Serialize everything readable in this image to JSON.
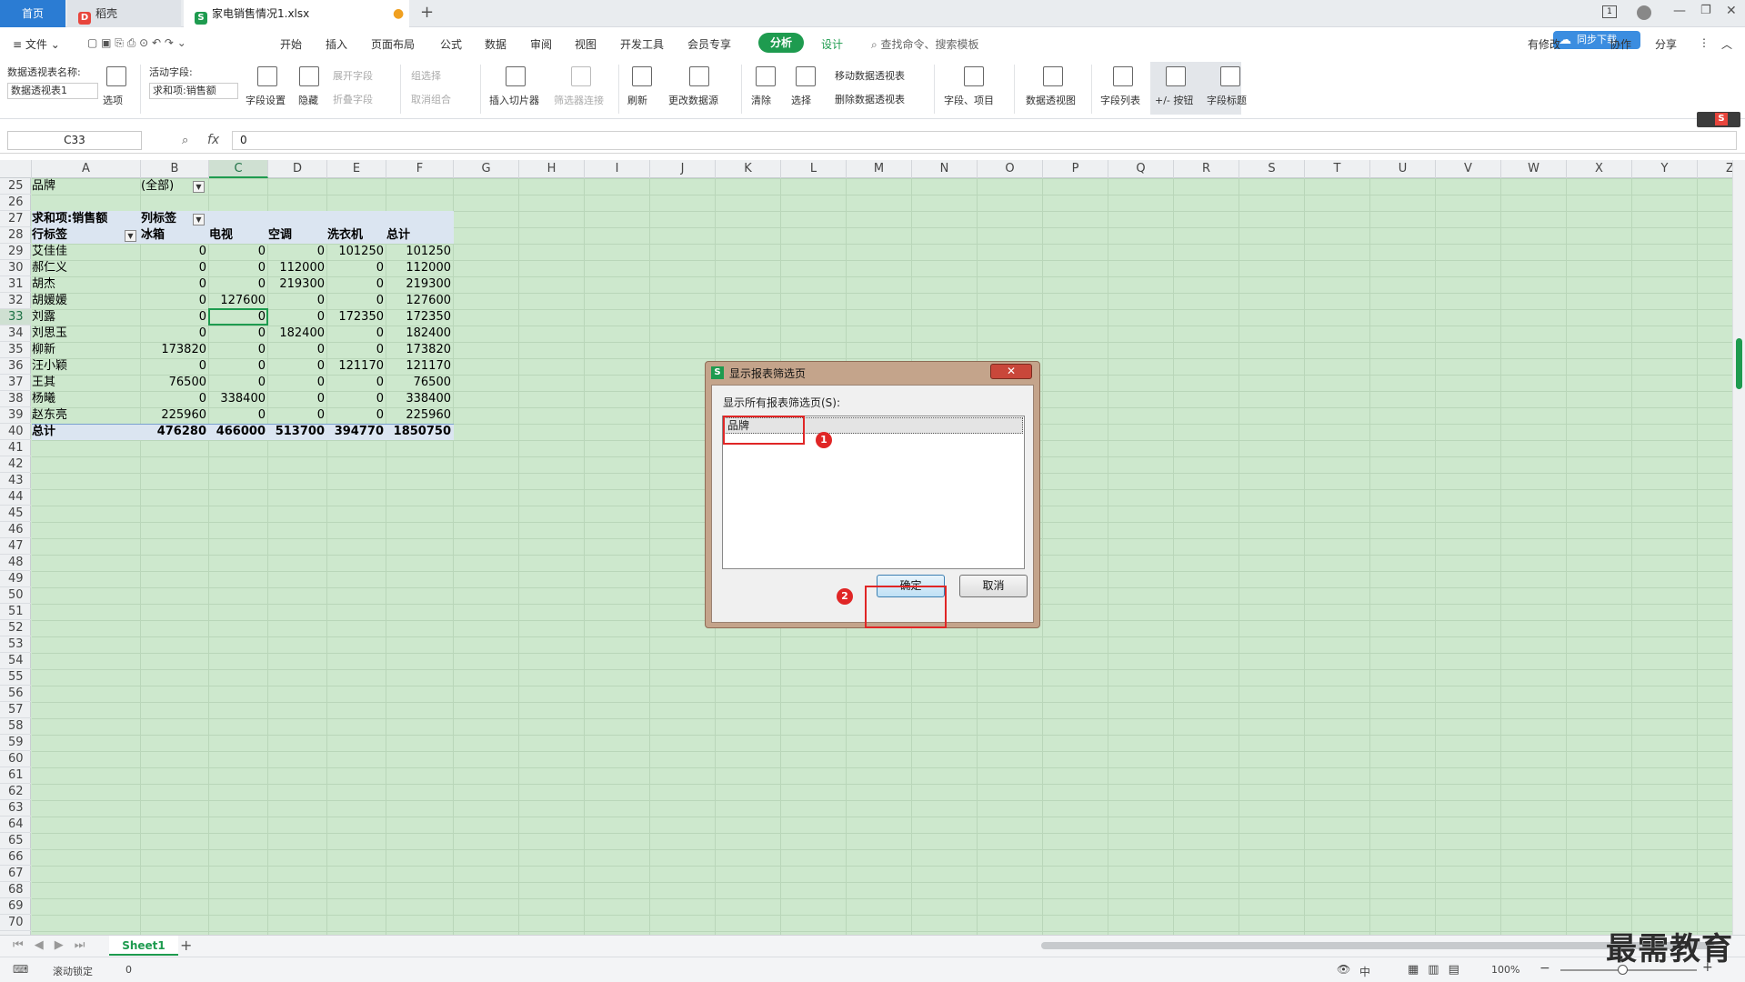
{
  "tabs": {
    "home": "首页",
    "daoke": "稻壳",
    "file": "家电销售情况1.xlsx",
    "new_tab": "+"
  },
  "menu": {
    "file": "文件",
    "items": [
      "开始",
      "插入",
      "页面布局",
      "公式",
      "数据",
      "审阅",
      "视图",
      "开发工具",
      "会员专享"
    ],
    "analyze": "分析",
    "design": "设计",
    "search": "查找命令、搜索模板",
    "right": [
      "有修改",
      "协作",
      "分享"
    ]
  },
  "ribbon": {
    "pt_name_label": "数据透视表名称:",
    "pt_name_value": "数据透视表1",
    "options": "选项",
    "active_field_label": "活动字段:",
    "active_field_value": "求和项:销售额",
    "field_settings": "字段设置",
    "hide": "隐藏",
    "expand_field": "展开字段",
    "collapse_field": "折叠字段",
    "group_select": "组选择",
    "ungroup": "取消组合",
    "insert_slicer": "插入切片器",
    "filter_conn": "筛选器连接",
    "refresh": "刷新",
    "change_source": "更改数据源",
    "clear": "清除",
    "select": "选择",
    "move_pt": "移动数据透视表",
    "delete_pt": "删除数据透视表",
    "fields_items": "字段、项目",
    "pivot_chart": "数据透视图",
    "field_list": "字段列表",
    "plus_minus": "+/- 按钮",
    "field_headers": "字段标题"
  },
  "formula": {
    "cell_ref": "C33",
    "fx": "fx",
    "value": "0"
  },
  "columns": [
    "A",
    "B",
    "C",
    "D",
    "E",
    "F",
    "G",
    "H",
    "I",
    "J",
    "K",
    "L",
    "M",
    "N",
    "O",
    "P",
    "Q",
    "R",
    "S",
    "T",
    "U",
    "V",
    "W",
    "X",
    "Y",
    "Z"
  ],
  "rows": [
    "25",
    "26",
    "27",
    "28",
    "29",
    "30",
    "31",
    "32",
    "33",
    "34",
    "35",
    "36",
    "37",
    "38",
    "39",
    "40",
    "41",
    "42",
    "43",
    "44",
    "45",
    "46",
    "47",
    "48",
    "49",
    "50",
    "51",
    "52",
    "53",
    "54",
    "55",
    "56",
    "57",
    "58",
    "59",
    "60",
    "61",
    "62",
    "63",
    "64",
    "65",
    "66",
    "67",
    "68",
    "69",
    "70"
  ],
  "pivot": {
    "filter_label": "品牌",
    "filter_value": "(全部)",
    "sum_label": "求和项:销售额",
    "col_label": "列标签",
    "row_label": "行标签",
    "headers": [
      "冰箱",
      "电视",
      "空调",
      "洗衣机",
      "总计"
    ],
    "data": [
      [
        "艾佳佳",
        "0",
        "0",
        "0",
        "101250",
        "101250"
      ],
      [
        "郝仁义",
        "0",
        "0",
        "112000",
        "0",
        "112000"
      ],
      [
        "胡杰",
        "0",
        "0",
        "219300",
        "0",
        "219300"
      ],
      [
        "胡媛媛",
        "0",
        "127600",
        "0",
        "0",
        "127600"
      ],
      [
        "刘露",
        "0",
        "0",
        "0",
        "172350",
        "172350"
      ],
      [
        "刘思玉",
        "0",
        "0",
        "182400",
        "0",
        "182400"
      ],
      [
        "柳新",
        "173820",
        "0",
        "0",
        "0",
        "173820"
      ],
      [
        "汪小颖",
        "0",
        "0",
        "0",
        "121170",
        "121170"
      ],
      [
        "王其",
        "76500",
        "0",
        "0",
        "0",
        "76500"
      ],
      [
        "杨曦",
        "0",
        "338400",
        "0",
        "0",
        "338400"
      ],
      [
        "赵东亮",
        "225960",
        "0",
        "0",
        "0",
        "225960"
      ]
    ],
    "total": [
      "总计",
      "476280",
      "466000",
      "513700",
      "394770",
      "1850750"
    ]
  },
  "dialog": {
    "title": "显示报表筛选页",
    "label": "显示所有报表筛选页(S):",
    "item": "品牌",
    "ok": "确定",
    "cancel": "取消",
    "close": "✕",
    "badge1": "1",
    "badge2": "2"
  },
  "sheet_tabs": {
    "active": "Sheet1",
    "add": "+"
  },
  "status": {
    "scroll_lock": "滚动锁定",
    "value": "0",
    "zoom": "100%",
    "lang": "中"
  },
  "watermark": "最需教育",
  "cloud_btn": "同步下载",
  "colors": {
    "sheet_bg": "#cde8cd",
    "accent_green": "#1e9b4f",
    "analyze_bg": "#1e9b4f",
    "home_tab": "#2b7cd3",
    "marker": "#e02626"
  }
}
